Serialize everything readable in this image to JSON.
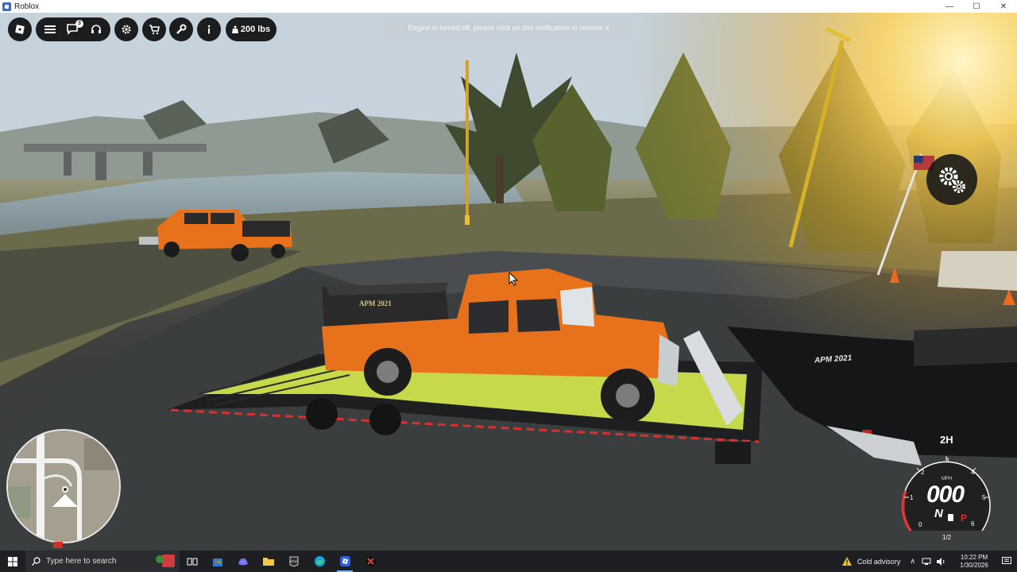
{
  "window": {
    "title": "Roblox",
    "controls": {
      "minimize": "—",
      "maximize": "☐",
      "close": "✕"
    }
  },
  "hud": {
    "chat_badge": "3",
    "weight_label": "200 lbs",
    "notification": "Engine is turned off, please click on this notification to remove it",
    "icons": [
      "roblox-menu-icon",
      "hamburger-menu-icon",
      "chat-icon",
      "headset-icon",
      "settings-icon",
      "cart-icon",
      "wrench-icon",
      "info-icon",
      "weight-icon"
    ]
  },
  "scene": {
    "trailer_text": "APM 2021",
    "truck_bed_text": "APM 2021"
  },
  "speedometer": {
    "drive_mode": "2H",
    "speed": "000",
    "unit": "MPH",
    "gear": "N",
    "park": "P",
    "ticks": [
      "0",
      "1",
      "2",
      "3",
      "4",
      "5",
      "6"
    ],
    "fraction_tick": "1/2"
  },
  "taskbar": {
    "search_placeholder": "Type here to search",
    "apps": [
      "task-view-icon",
      "microsoft-store-icon",
      "copilot-icon",
      "file-explorer-icon",
      "epic-games-icon",
      "edge-icon",
      "roblox-icon",
      "roblox-studio-icon"
    ],
    "weather": "Cold advisory",
    "time": "10:22 PM",
    "date": "1/30/2026"
  },
  "colors": {
    "hud_dark": "#1b1d1f",
    "truck_orange": "#e8711c",
    "trailer_deck": "#c7d94a",
    "taskbar": "#1e1f22"
  }
}
